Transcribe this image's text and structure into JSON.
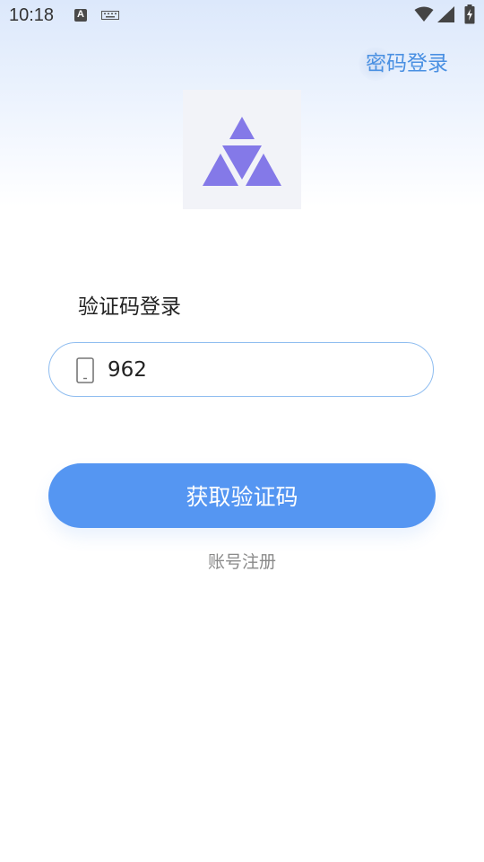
{
  "status_bar": {
    "time": "10:18",
    "notification_icons": [
      "a-icon",
      "keyboard-icon"
    ],
    "system_icons": [
      "wifi-icon",
      "signal-icon",
      "battery-charging-icon"
    ]
  },
  "header": {
    "switch_mode_label": "密码登录"
  },
  "logo": {
    "icon": "triangle-logo-icon",
    "color": "#8479e8"
  },
  "form": {
    "title": "验证码登录",
    "phone_value": "962",
    "phone_icon": "phone-icon",
    "submit_label": "获取验证码",
    "register_label": "账号注册"
  },
  "colors": {
    "accent": "#5596f2",
    "link": "#4a90e2",
    "field_border": "#8fbdf0"
  }
}
